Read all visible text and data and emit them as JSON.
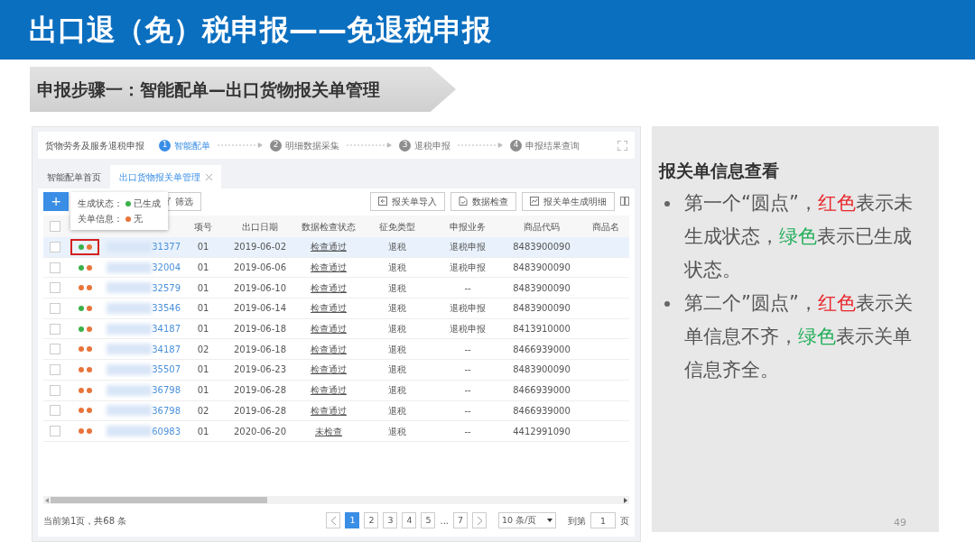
{
  "slide_title": "出口退（免）税申报——免退税申报",
  "step_banner": "申报步骤一：智能配单—出口货物报关单管理",
  "app": {
    "title": "货物劳务及服务退税申报",
    "steps": [
      {
        "number": "1",
        "label": "智能配单",
        "selected": true
      },
      {
        "number": "2",
        "label": "明细数据采集",
        "selected": false
      },
      {
        "number": "3",
        "label": "退税申报",
        "selected": false
      },
      {
        "number": "4",
        "label": "申报结果查询",
        "selected": false
      }
    ],
    "tabs": [
      {
        "label": "智能配单首页",
        "selected": false,
        "closable": false
      },
      {
        "label": "出口货物报关单管理",
        "selected": true,
        "closable": true
      }
    ],
    "add_button": "+",
    "filter_button": "筛选",
    "select_all_checked": false,
    "actions": [
      {
        "label": "报关单导入",
        "kind": "import"
      },
      {
        "label": "数据检查",
        "kind": "check"
      },
      {
        "label": "报关单生成明细",
        "kind": "generate"
      }
    ],
    "tooltip": [
      {
        "label": "生成状态：",
        "value": "已生成",
        "color": "#3cb04a"
      },
      {
        "label": "关单信息：",
        "value": "无",
        "color": "#e8743b"
      }
    ],
    "columns": [
      "项号",
      "出口日期",
      "数据检查状态",
      "征免类型",
      "申报业务",
      "商品代码",
      "商品名"
    ],
    "rows": [
      {
        "selected": true,
        "checked": false,
        "framed": true,
        "generated": true,
        "complete": false,
        "id": "31377",
        "item": "01",
        "date": "2019-06-02",
        "check": "检查通过",
        "type": "退税",
        "business": "退税申报",
        "code": "8483900090"
      },
      {
        "selected": false,
        "checked": false,
        "framed": false,
        "generated": true,
        "complete": false,
        "id": "32004",
        "item": "01",
        "date": "2019-06-06",
        "check": "检查通过",
        "type": "退税",
        "business": "退税申报",
        "code": "8483900090"
      },
      {
        "selected": false,
        "checked": false,
        "framed": false,
        "generated": false,
        "complete": false,
        "id": "32579",
        "item": "01",
        "date": "2019-06-10",
        "check": "检查通过",
        "type": "退税",
        "business": "--",
        "code": "8483900090"
      },
      {
        "selected": false,
        "checked": false,
        "framed": false,
        "generated": true,
        "complete": false,
        "id": "33546",
        "item": "01",
        "date": "2019-06-14",
        "check": "检查通过",
        "type": "退税",
        "business": "退税申报",
        "code": "8483900090"
      },
      {
        "selected": false,
        "checked": false,
        "framed": false,
        "generated": true,
        "complete": false,
        "id": "34187",
        "item": "01",
        "date": "2019-06-18",
        "check": "检查通过",
        "type": "退税",
        "business": "退税申报",
        "code": "8413910000"
      },
      {
        "selected": false,
        "checked": false,
        "framed": false,
        "generated": false,
        "complete": false,
        "id": "34187",
        "item": "02",
        "date": "2019-06-18",
        "check": "检查通过",
        "type": "退税",
        "business": "--",
        "code": "8466939000"
      },
      {
        "selected": false,
        "checked": false,
        "framed": false,
        "generated": false,
        "complete": false,
        "id": "35507",
        "item": "01",
        "date": "2019-06-23",
        "check": "检查通过",
        "type": "退税",
        "business": "--",
        "code": "8483900090"
      },
      {
        "selected": false,
        "checked": false,
        "framed": false,
        "generated": false,
        "complete": false,
        "id": "36798",
        "item": "01",
        "date": "2019-06-28",
        "check": "检查通过",
        "type": "退税",
        "business": "--",
        "code": "8466939000"
      },
      {
        "selected": false,
        "checked": false,
        "framed": false,
        "generated": false,
        "complete": false,
        "id": "36798",
        "item": "02",
        "date": "2019-06-28",
        "check": "检查通过",
        "type": "退税",
        "business": "--",
        "code": "8466939000"
      },
      {
        "selected": false,
        "checked": false,
        "framed": false,
        "generated": false,
        "complete": false,
        "id": "60983",
        "item": "01",
        "date": "2020-06-20",
        "check": "未检查",
        "type": "退税",
        "business": "--",
        "code": "4412991090"
      }
    ],
    "summary": "当前第1页，共68 条",
    "pages": [
      {
        "label": "1",
        "kind": "page",
        "selected": true
      },
      {
        "label": "2",
        "kind": "page",
        "selected": false
      },
      {
        "label": "3",
        "kind": "page",
        "selected": false
      },
      {
        "label": "4",
        "kind": "page",
        "selected": false
      },
      {
        "label": "5",
        "kind": "page",
        "selected": false
      },
      {
        "label": "...",
        "kind": "gap"
      },
      {
        "label": "7",
        "kind": "page",
        "selected": false
      }
    ],
    "page_size": "10 条/页",
    "goto_label": "到第",
    "goto_value": "1",
    "goto_suffix": "页"
  },
  "panel": {
    "heading": "报关单信息查看",
    "bullets": [
      [
        {
          "text": "第一个“圆点”，"
        },
        {
          "text": "红色",
          "color": "#e8262b"
        },
        {
          "text": "表示未生成状态，"
        },
        {
          "text": "绿色",
          "color": "#1fae57"
        },
        {
          "text": "表示已生成状态。"
        }
      ],
      [
        {
          "text": "第二个”圆点”，"
        },
        {
          "text": "红色",
          "color": "#e8262b"
        },
        {
          "text": "表示关单信息不齐，"
        },
        {
          "text": "绿色",
          "color": "#1fae57"
        },
        {
          "text": "表示关单信息齐全。"
        }
      ]
    ]
  },
  "page_number": "49"
}
